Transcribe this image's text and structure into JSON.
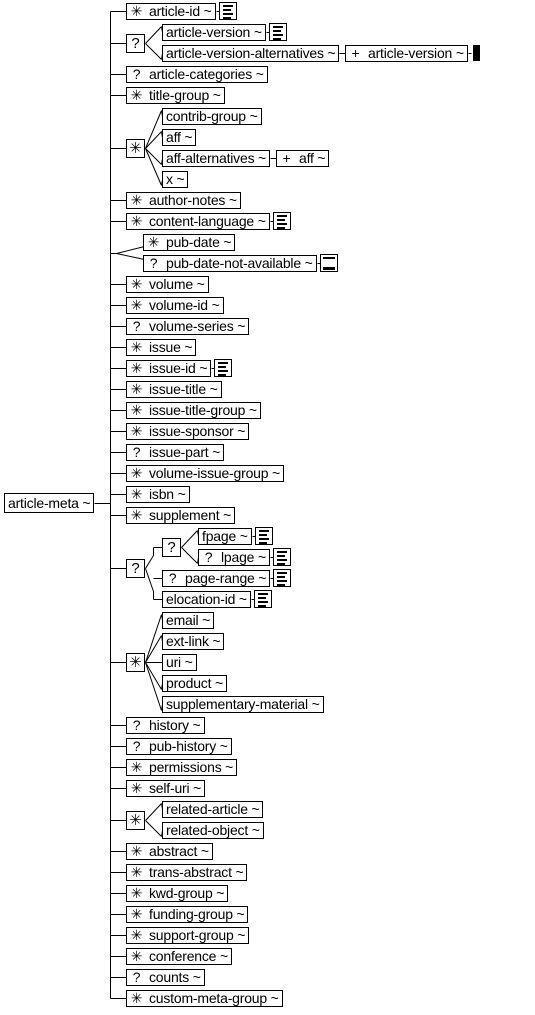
{
  "root": {
    "label": "article-meta ~"
  },
  "tilde": "~",
  "icons": {
    "text-content": "text-lines-icon",
    "empty-content": "empty-element-icon",
    "solid-content": "filled-content-icon"
  },
  "occurrence_symbols": {
    "zero_or_more": "✳",
    "optional": "?",
    "one_or_more": "+"
  },
  "children": [
    {
      "type": "element",
      "occ": "✳",
      "label": "article-id ~",
      "icon": "text-content"
    },
    {
      "type": "compositor",
      "occ": "?",
      "children": [
        {
          "type": "element",
          "label": "article-version ~",
          "icon": "text-content"
        },
        {
          "type": "element",
          "label": "article-version-alternatives ~",
          "sub": {
            "occ": "+",
            "label": "article-version ~",
            "icon": "solid-content"
          }
        }
      ]
    },
    {
      "type": "element",
      "occ": "?",
      "label": "article-categories ~"
    },
    {
      "type": "element",
      "occ": "✳",
      "label": "title-group ~"
    },
    {
      "type": "compositor",
      "occ": "✳",
      "children": [
        {
          "type": "element",
          "label": "contrib-group ~"
        },
        {
          "type": "element",
          "label": "aff ~"
        },
        {
          "type": "element",
          "label": "aff-alternatives ~",
          "sub": {
            "occ": "+",
            "label": "aff ~"
          }
        },
        {
          "type": "element",
          "label": "x ~"
        }
      ]
    },
    {
      "type": "element",
      "occ": "✳",
      "label": "author-notes ~"
    },
    {
      "type": "element",
      "occ": "✳",
      "label": "content-language ~",
      "icon": "text-content"
    },
    {
      "type": "choice",
      "children": [
        {
          "type": "element",
          "occ": "✳",
          "label": "pub-date ~"
        },
        {
          "type": "element",
          "occ": "?",
          "label": "pub-date-not-available ~",
          "icon": "empty-content"
        }
      ]
    },
    {
      "type": "element",
      "occ": "✳",
      "label": "volume ~"
    },
    {
      "type": "element",
      "occ": "✳",
      "label": "volume-id ~"
    },
    {
      "type": "element",
      "occ": "?",
      "label": "volume-series ~"
    },
    {
      "type": "element",
      "occ": "✳",
      "label": "issue ~"
    },
    {
      "type": "element",
      "occ": "✳",
      "label": "issue-id ~",
      "icon": "text-content"
    },
    {
      "type": "element",
      "occ": "✳",
      "label": "issue-title ~"
    },
    {
      "type": "element",
      "occ": "✳",
      "label": "issue-title-group ~"
    },
    {
      "type": "element",
      "occ": "✳",
      "label": "issue-sponsor ~"
    },
    {
      "type": "element",
      "occ": "?",
      "label": "issue-part ~"
    },
    {
      "type": "element",
      "occ": "✳",
      "label": "volume-issue-group ~"
    },
    {
      "type": "element",
      "occ": "✳",
      "label": "isbn ~"
    },
    {
      "type": "element",
      "occ": "✳",
      "label": "supplement ~"
    },
    {
      "type": "compositor",
      "occ": "?",
      "children": [
        {
          "type": "compositor",
          "occ": "?",
          "children": [
            {
              "type": "element",
              "label": "fpage ~",
              "icon": "text-content"
            },
            {
              "type": "element",
              "occ": "?",
              "label": "lpage ~",
              "icon": "text-content"
            }
          ]
        },
        {
          "type": "element",
          "occ": "?",
          "label": "page-range ~",
          "icon": "text-content"
        },
        {
          "type": "element",
          "label": "elocation-id ~",
          "icon": "text-content"
        }
      ]
    },
    {
      "type": "compositor",
      "occ": "✳",
      "children": [
        {
          "type": "element",
          "label": "email ~"
        },
        {
          "type": "element",
          "label": "ext-link ~"
        },
        {
          "type": "element",
          "label": "uri ~"
        },
        {
          "type": "element",
          "label": "product ~"
        },
        {
          "type": "element",
          "label": "supplementary-material ~"
        }
      ]
    },
    {
      "type": "element",
      "occ": "?",
      "label": "history ~"
    },
    {
      "type": "element",
      "occ": "?",
      "label": "pub-history ~"
    },
    {
      "type": "element",
      "occ": "✳",
      "label": "permissions ~"
    },
    {
      "type": "element",
      "occ": "✳",
      "label": "self-uri ~"
    },
    {
      "type": "compositor",
      "occ": "✳",
      "children": [
        {
          "type": "element",
          "label": "related-article ~"
        },
        {
          "type": "element",
          "label": "related-object ~"
        }
      ]
    },
    {
      "type": "element",
      "occ": "✳",
      "label": "abstract ~"
    },
    {
      "type": "element",
      "occ": "✳",
      "label": "trans-abstract ~"
    },
    {
      "type": "element",
      "occ": "✳",
      "label": "kwd-group ~"
    },
    {
      "type": "element",
      "occ": "✳",
      "label": "funding-group ~"
    },
    {
      "type": "element",
      "occ": "✳",
      "label": "support-group ~"
    },
    {
      "type": "element",
      "occ": "✳",
      "label": "conference ~"
    },
    {
      "type": "element",
      "occ": "?",
      "label": "counts ~"
    },
    {
      "type": "element",
      "occ": "✳",
      "label": "custom-meta-group ~"
    }
  ]
}
